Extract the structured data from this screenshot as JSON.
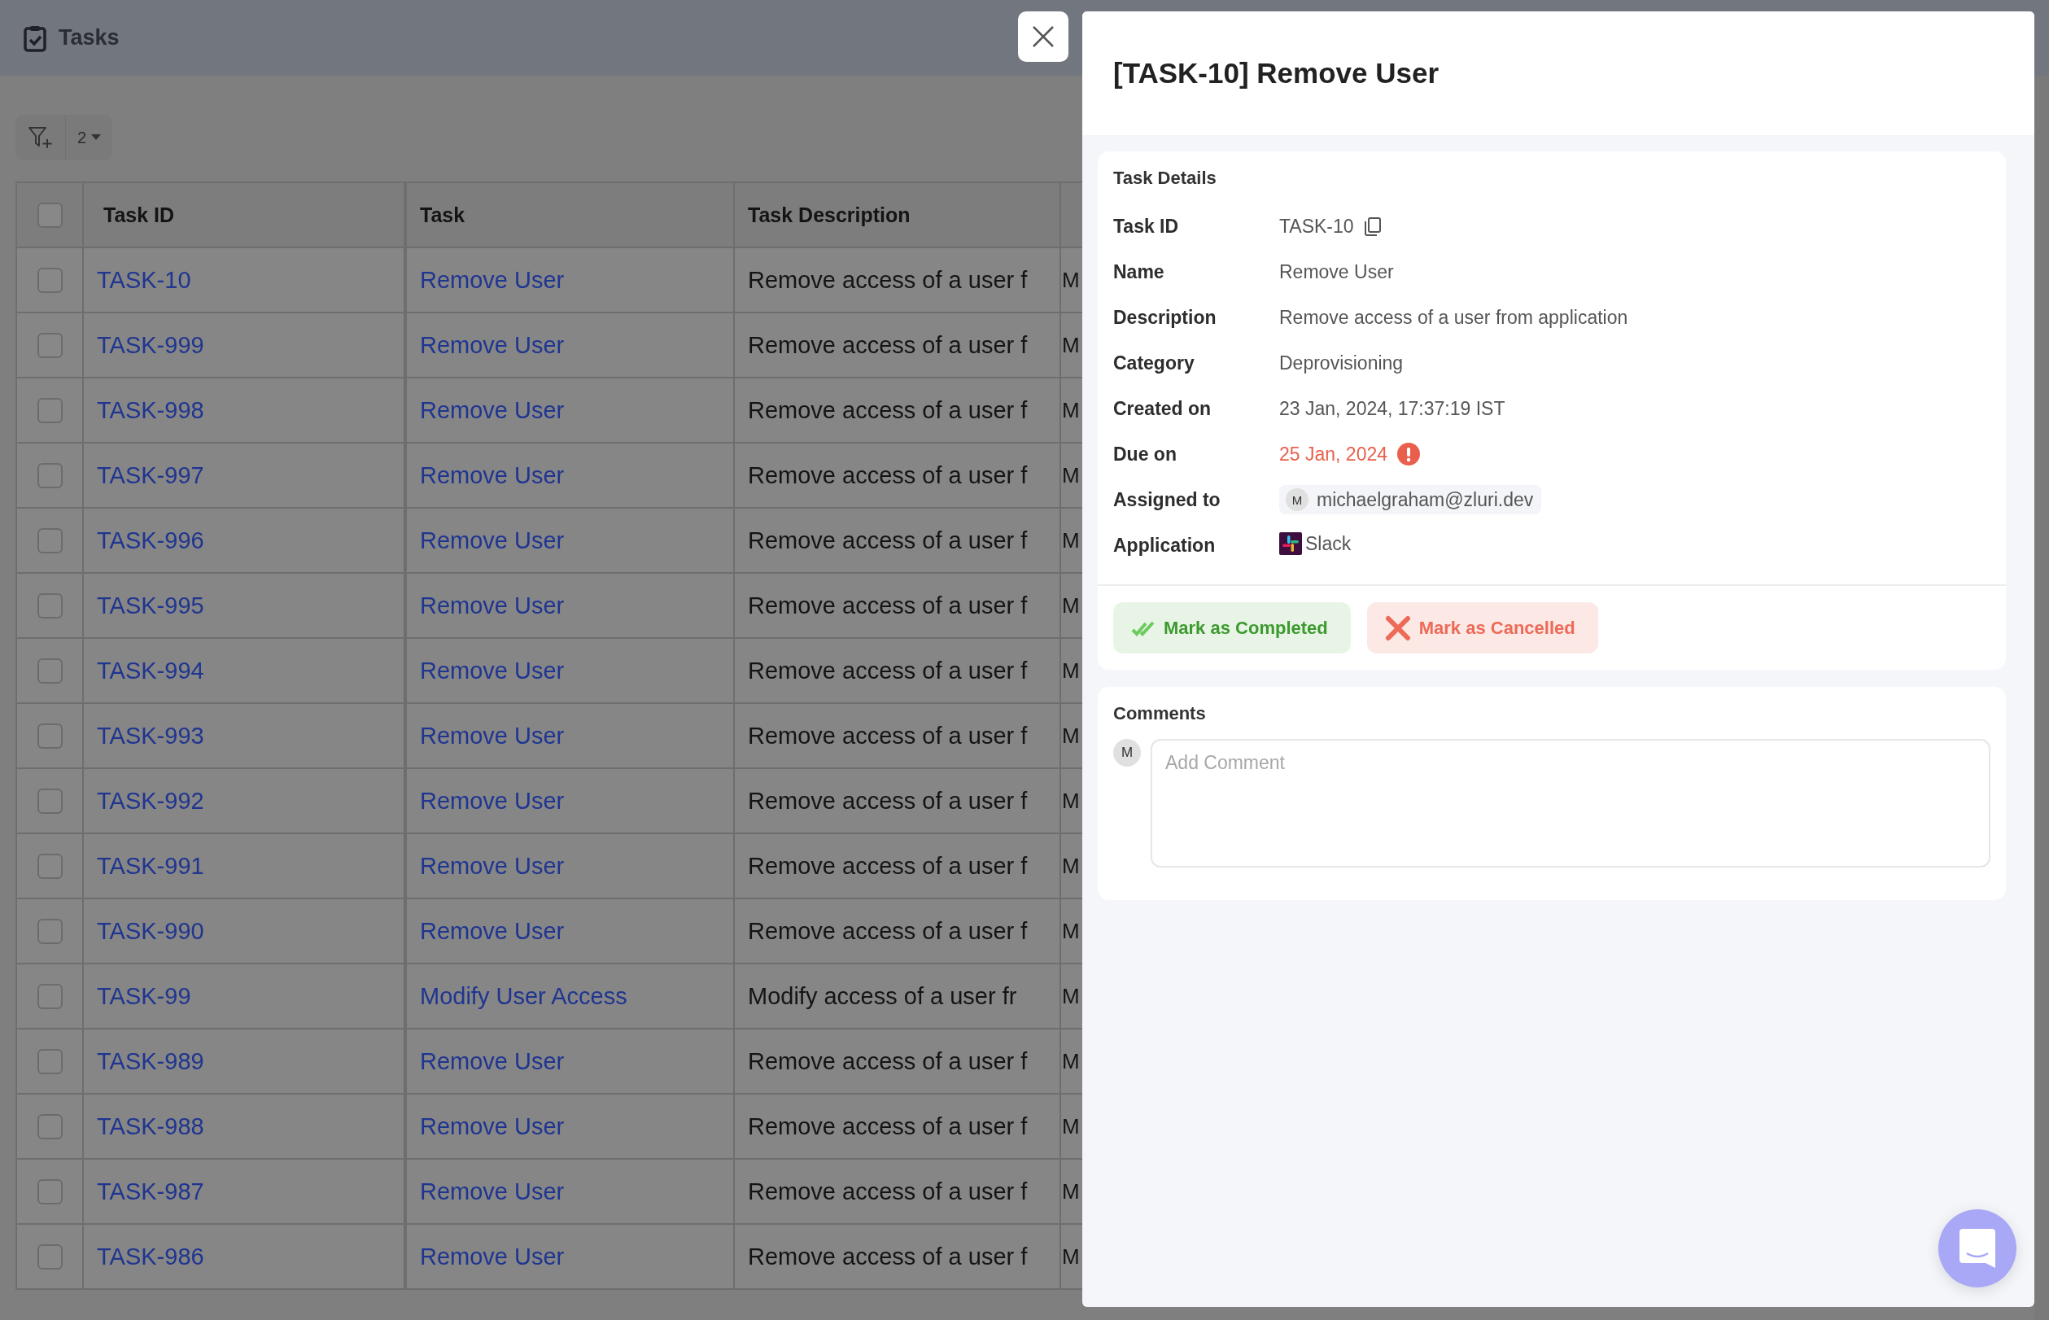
{
  "app": {
    "title": "Tasks"
  },
  "toolbar": {
    "filter_count": "2"
  },
  "table": {
    "select_all": {
      "checked": false
    },
    "columns": [
      "Task ID",
      "Task",
      "Task Description"
    ],
    "rows": [
      {
        "checked": false,
        "task_id": "TASK-10",
        "task": "Remove User",
        "description": "Remove access of a user f",
        "column_4": "M"
      },
      {
        "checked": false,
        "task_id": "TASK-999",
        "task": "Remove User",
        "description": "Remove access of a user f",
        "column_4": "M"
      },
      {
        "checked": false,
        "task_id": "TASK-998",
        "task": "Remove User",
        "description": "Remove access of a user f",
        "column_4": "M"
      },
      {
        "checked": false,
        "task_id": "TASK-997",
        "task": "Remove User",
        "description": "Remove access of a user f",
        "column_4": "M"
      },
      {
        "checked": false,
        "task_id": "TASK-996",
        "task": "Remove User",
        "description": "Remove access of a user f",
        "column_4": "M"
      },
      {
        "checked": false,
        "task_id": "TASK-995",
        "task": "Remove User",
        "description": "Remove access of a user f",
        "column_4": "M"
      },
      {
        "checked": false,
        "task_id": "TASK-994",
        "task": "Remove User",
        "description": "Remove access of a user f",
        "column_4": "M"
      },
      {
        "checked": false,
        "task_id": "TASK-993",
        "task": "Remove User",
        "description": "Remove access of a user f",
        "column_4": "M"
      },
      {
        "checked": false,
        "task_id": "TASK-992",
        "task": "Remove User",
        "description": "Remove access of a user f",
        "column_4": "M"
      },
      {
        "checked": false,
        "task_id": "TASK-991",
        "task": "Remove User",
        "description": "Remove access of a user f",
        "column_4": "M"
      },
      {
        "checked": false,
        "task_id": "TASK-990",
        "task": "Remove User",
        "description": "Remove access of a user f",
        "column_4": "M"
      },
      {
        "checked": false,
        "task_id": "TASK-99",
        "task": "Modify User Access",
        "description": "Modify access of a user fr",
        "column_4": "M"
      },
      {
        "checked": false,
        "task_id": "TASK-989",
        "task": "Remove User",
        "description": "Remove access of a user f",
        "column_4": "M"
      },
      {
        "checked": false,
        "task_id": "TASK-988",
        "task": "Remove User",
        "description": "Remove access of a user f",
        "column_4": "M"
      },
      {
        "checked": false,
        "task_id": "TASK-987",
        "task": "Remove User",
        "description": "Remove access of a user f",
        "column_4": "M"
      },
      {
        "checked": false,
        "task_id": "TASK-986",
        "task": "Remove User",
        "description": "Remove access of a user f",
        "column_4": "M"
      }
    ]
  },
  "drawer": {
    "title": "[TASK-10] Remove User",
    "details_title": "Task Details",
    "fields": [
      {
        "kind": "copy",
        "label": "Task ID",
        "value": "TASK-10"
      },
      {
        "kind": "text",
        "label": "Name",
        "value": "Remove User"
      },
      {
        "kind": "text",
        "label": "Description",
        "value": "Remove access of a user from application"
      },
      {
        "kind": "text",
        "label": "Category",
        "value": "Deprovisioning"
      },
      {
        "kind": "text",
        "label": "Created on",
        "value": "23 Jan, 2024, 17:37:19 IST"
      },
      {
        "kind": "overdue",
        "label": "Due on",
        "value": "25 Jan, 2024"
      },
      {
        "kind": "user",
        "label": "Assigned to",
        "avatar": "M",
        "value": "michaelgraham@zluri.dev"
      },
      {
        "kind": "app",
        "label": "Application",
        "value": "Slack"
      }
    ],
    "actions": [
      {
        "kind": "complete",
        "label": "Mark as Completed"
      },
      {
        "kind": "cancel",
        "label": "Mark as Cancelled"
      }
    ],
    "comments": {
      "title": "Comments",
      "avatar": "M",
      "placeholder": "Add Comment"
    }
  }
}
